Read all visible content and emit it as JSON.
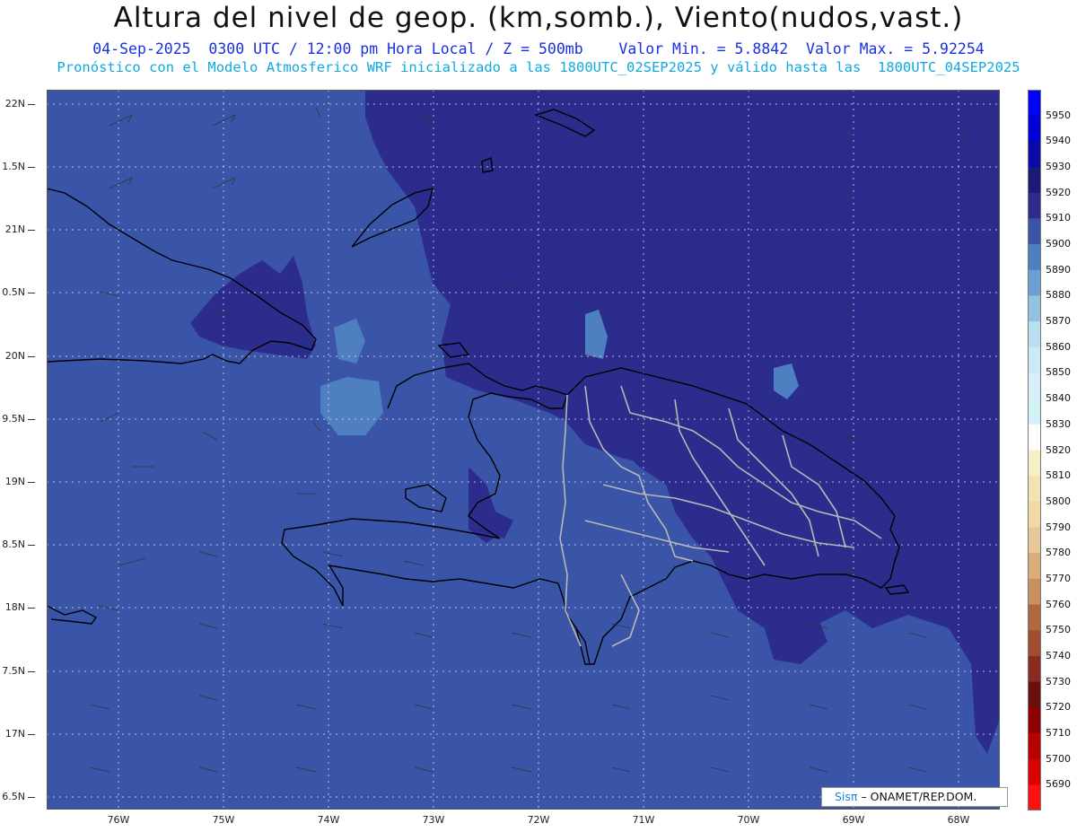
{
  "header": {
    "title": "Altura del nivel de geop. (km,somb.), Viento(nudos,vast.)",
    "line1": "04-Sep-2025  0300 UTC / 12:00 pm Hora Local / Z = 500mb    Valor Min. = 5.8842  Valor Max. = 5.92254",
    "line2": "Pronóstico con el Modelo Atmosferico WRF inicializado a las 1800UTC_02SEP2025 y válido hasta las  1800UTC_04SEP2025"
  },
  "axes": {
    "lat_labels": [
      "22N",
      "1.5N",
      "21N",
      "0.5N",
      "20N",
      "9.5N",
      "19N",
      "8.5N",
      "18N",
      "7.5N",
      "17N",
      "6.5N"
    ],
    "lon_labels": [
      "76W",
      "75W",
      "74W",
      "73W",
      "72W",
      "71W",
      "70W",
      "69W",
      "68W"
    ]
  },
  "colorbar": {
    "levels": [
      "5950",
      "5940",
      "5930",
      "5920",
      "5910",
      "5900",
      "5890",
      "5880",
      "5870",
      "5860",
      "5850",
      "5840",
      "5830",
      "5820",
      "5810",
      "5800",
      "5790",
      "5780",
      "5770",
      "5760",
      "5750",
      "5740",
      "5730",
      "5720",
      "5710",
      "5700",
      "5690"
    ],
    "colors": [
      "#0000ff",
      "#0000d8",
      "#0a0aa8",
      "#1a1a78",
      "#2c2c8c",
      "#3a55a8",
      "#4e7fc0",
      "#6a9fd0",
      "#93c2e0",
      "#b9dff0",
      "#cde9f5",
      "#d6eff8",
      "#d2f2f8",
      "#ffffff",
      "#f7efc5",
      "#f2e4b2",
      "#efdaa6",
      "#e6c89a",
      "#d9ae7a",
      "#c99060",
      "#b06840",
      "#a04e30",
      "#8a2a20",
      "#6a0f0f",
      "#900000",
      "#b80000",
      "#d80000",
      "#ff1010"
    ]
  },
  "map_colors": {
    "ocean": "#3a55a8",
    "high": "#2c2c8c",
    "low": "#4e7fc0",
    "coast": "#000000",
    "border": "#b0b0b0"
  },
  "credit": {
    "sis": "Sisπ",
    "text": "– ONAMET/REP.DOM."
  }
}
